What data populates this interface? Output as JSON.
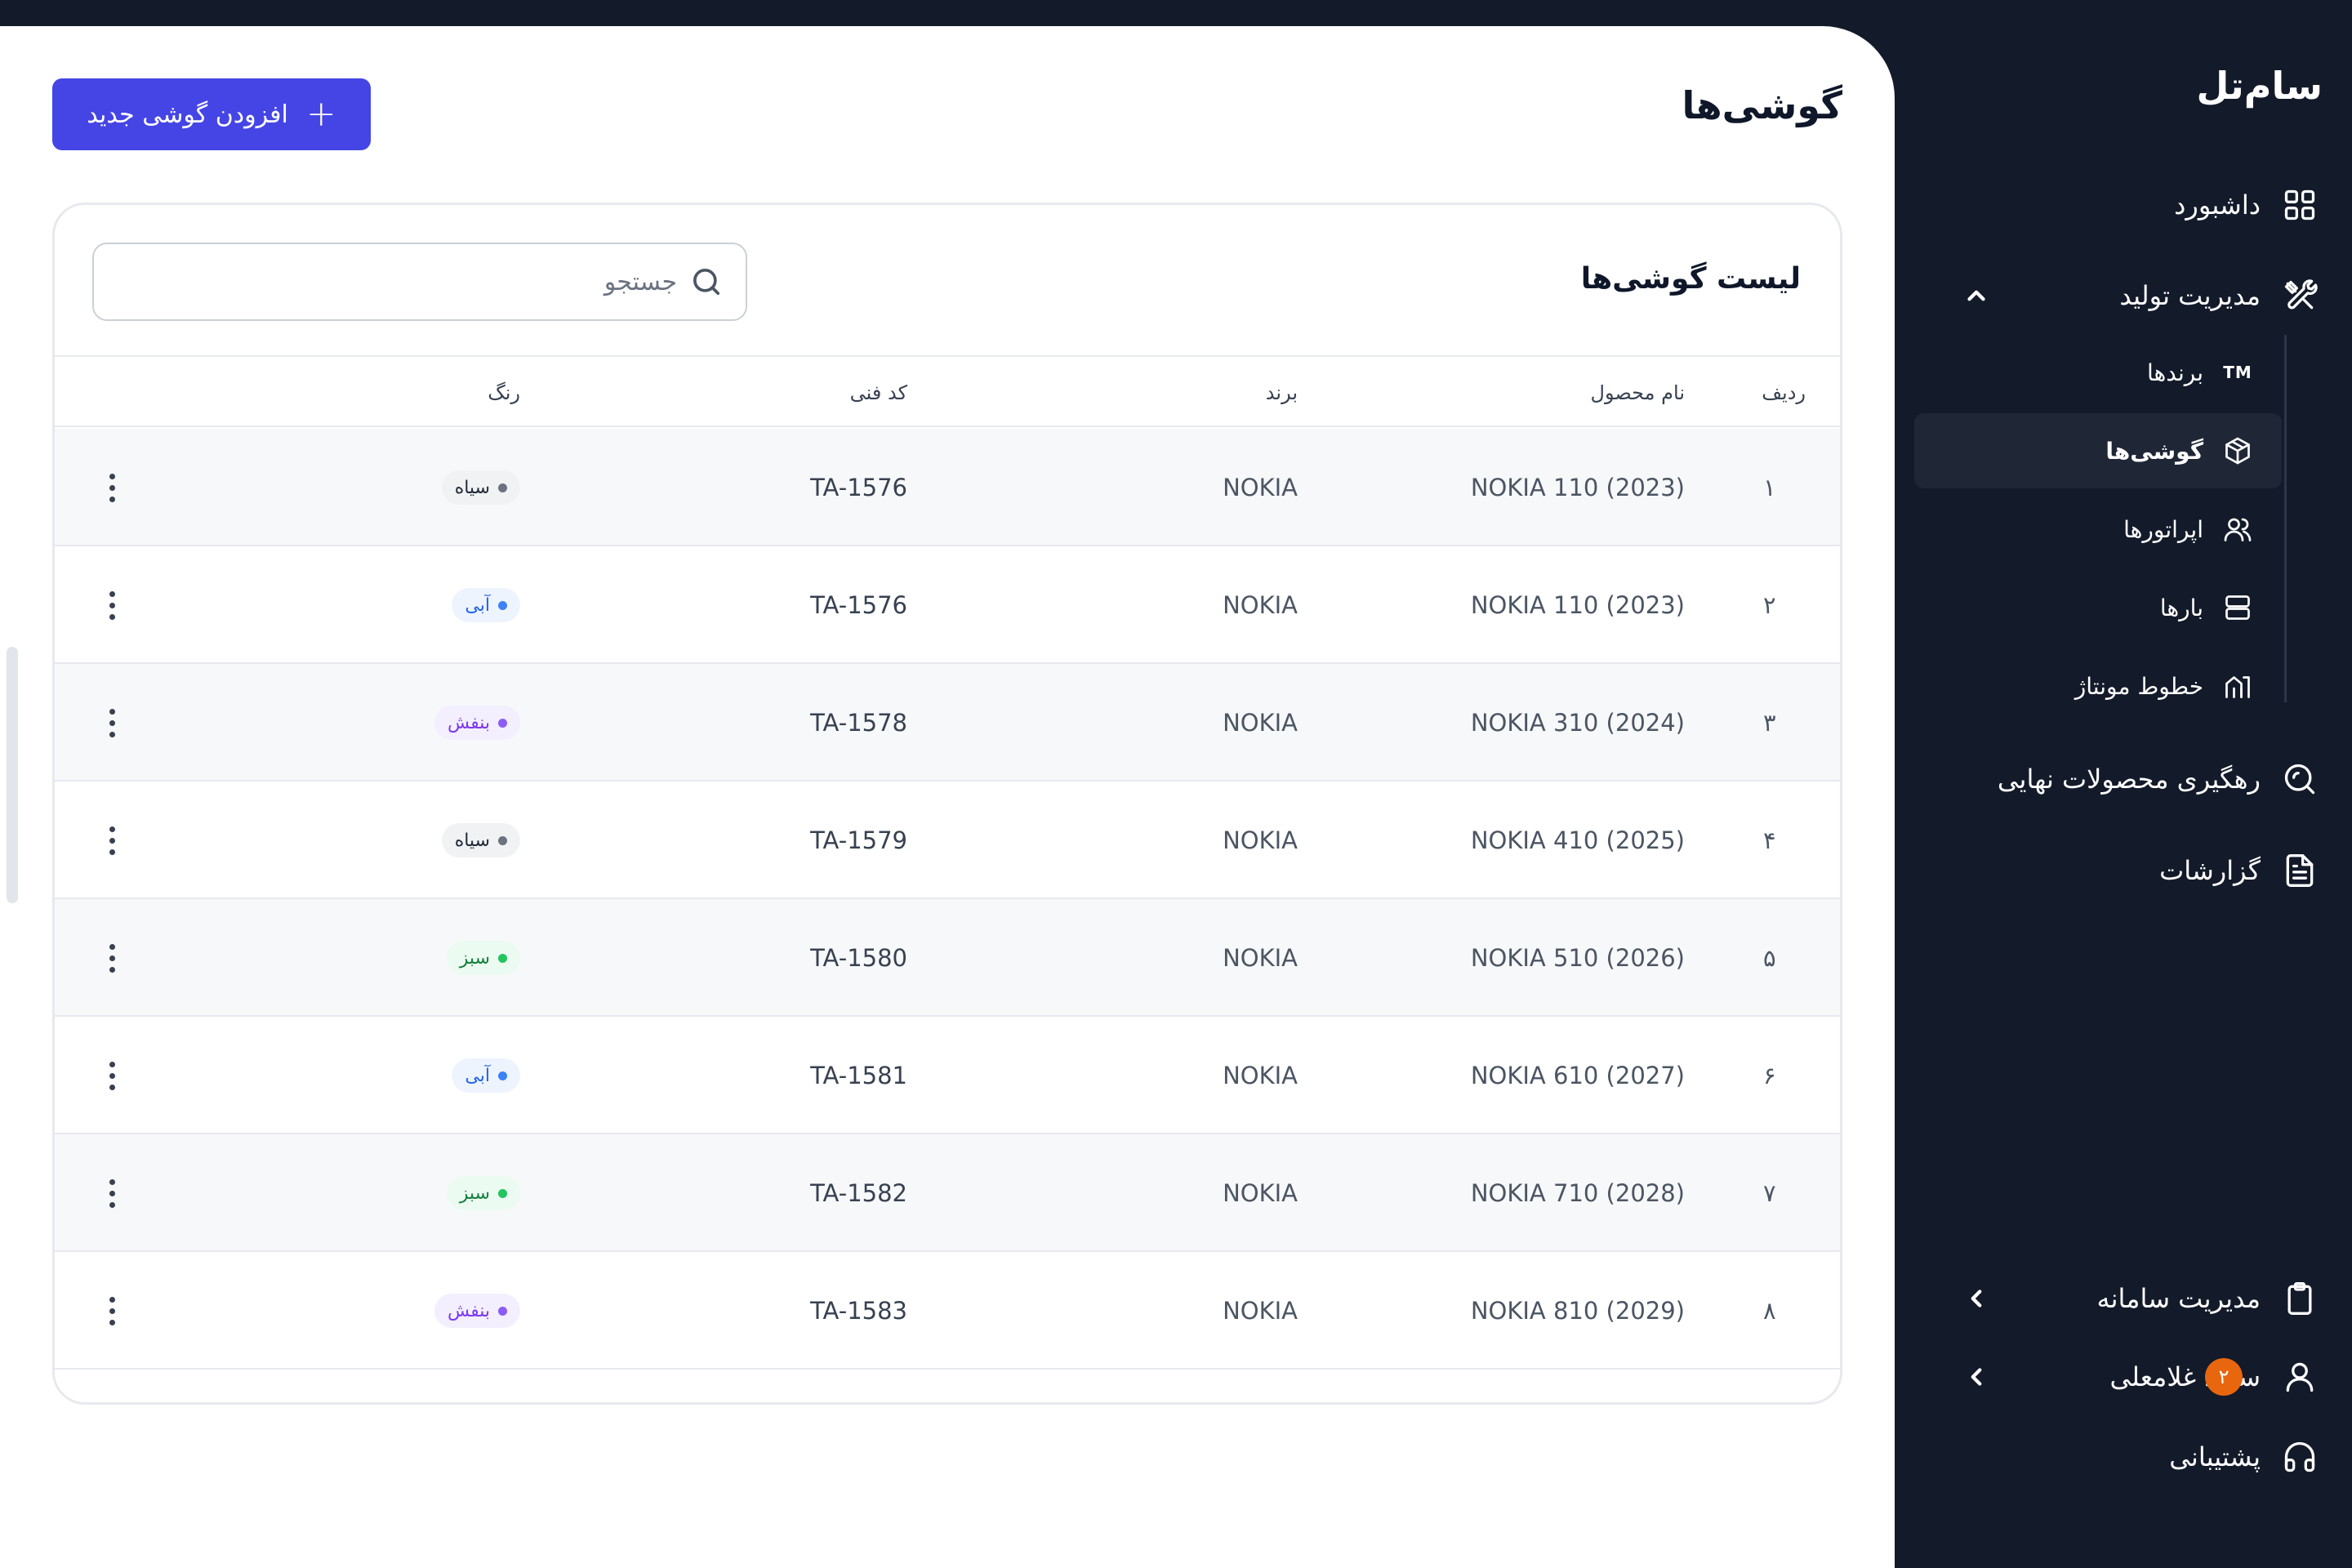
{
  "sidebar": {
    "logo": "سام‌تل",
    "items": [
      {
        "label": "داشبورد",
        "icon": "dashboard-grid-icon"
      },
      {
        "label": "مدیریت تولید",
        "icon": "tools-icon"
      },
      {
        "label": "رهگیری محصولات نهایی",
        "icon": "search-trace-icon"
      },
      {
        "label": "گزارشات",
        "icon": "report-icon"
      },
      {
        "label": "مدیریت سامانه",
        "icon": "clipboard-icon"
      },
      {
        "label": "سعید غلامعلی",
        "icon": "user-icon",
        "badge": "۲"
      },
      {
        "label": "پشتیبانی",
        "icon": "headset-icon"
      }
    ],
    "sub_items": [
      {
        "label": "برندها",
        "icon": "tm-icon",
        "icon_text": "TM"
      },
      {
        "label": "گوشی‌ها",
        "icon": "box-icon",
        "active": true
      },
      {
        "label": "اپراتورها",
        "icon": "users-icon"
      },
      {
        "label": "بارها",
        "icon": "server-icon"
      },
      {
        "label": "خطوط مونتاژ",
        "icon": "assembly-line-icon"
      }
    ]
  },
  "header": {
    "title": "گوشی‌ها",
    "add_button_label": "افزودن گوشی جدید"
  },
  "list": {
    "title": "لیست گوشی‌ها",
    "search_placeholder": "جستجو",
    "columns": {
      "index": "ردیف",
      "name": "نام محصول",
      "brand": "برند",
      "code": "کد فنی",
      "color": "رنگ"
    },
    "rows": [
      {
        "index": "۱",
        "name": "NOKIA 110 (2023)",
        "brand": "NOKIA",
        "code": "TA-1576",
        "color": "سیاه",
        "color_key": "black"
      },
      {
        "index": "۲",
        "name": "NOKIA 110 (2023)",
        "brand": "NOKIA",
        "code": "TA-1576",
        "color": "آبی",
        "color_key": "blue"
      },
      {
        "index": "۳",
        "name": "NOKIA 310 (2024)",
        "brand": "NOKIA",
        "code": "TA-1578",
        "color": "بنفش",
        "color_key": "purple"
      },
      {
        "index": "۴",
        "name": "NOKIA 410 (2025)",
        "brand": "NOKIA",
        "code": "TA-1579",
        "color": "سیاه",
        "color_key": "black"
      },
      {
        "index": "۵",
        "name": "NOKIA 510 (2026)",
        "brand": "NOKIA",
        "code": "TA-1580",
        "color": "سبز",
        "color_key": "green"
      },
      {
        "index": "۶",
        "name": "NOKIA 610 (2027)",
        "brand": "NOKIA",
        "code": "TA-1581",
        "color": "آبی",
        "color_key": "blue"
      },
      {
        "index": "۷",
        "name": "NOKIA 710 (2028)",
        "brand": "NOKIA",
        "code": "TA-1582",
        "color": "سبز",
        "color_key": "green"
      },
      {
        "index": "۸",
        "name": "NOKIA 810 (2029)",
        "brand": "NOKIA",
        "code": "TA-1583",
        "color": "بنفش",
        "color_key": "purple"
      }
    ]
  },
  "colors": {
    "sidebar_bg": "#131a2a",
    "accent": "#4545e6",
    "badge": "#e8660d",
    "chips": {
      "black": {
        "bg": "#f1f2f4",
        "dot": "#6b7280",
        "text": "#1f2937"
      },
      "blue": {
        "bg": "#eef4fe",
        "dot": "#3b82f6",
        "text": "#2563eb"
      },
      "purple": {
        "bg": "#f3efff",
        "dot": "#8b5cf6",
        "text": "#7c3aed"
      },
      "green": {
        "bg": "#ecfbf1",
        "dot": "#22c55e",
        "text": "#15803d"
      }
    }
  }
}
